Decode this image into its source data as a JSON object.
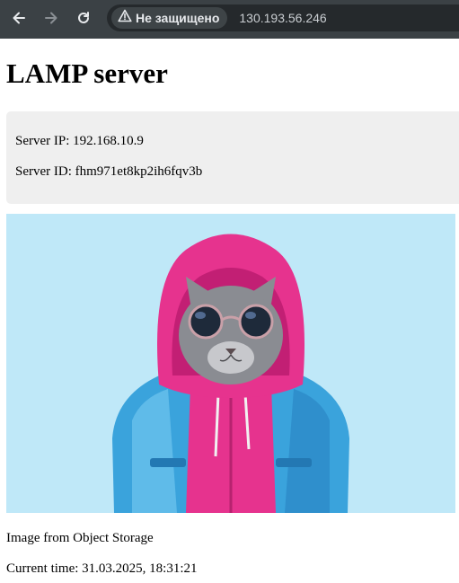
{
  "browser": {
    "security_label": "Не защищено",
    "url": "130.193.56.246",
    "icons": {
      "back": "arrow-left-icon",
      "forward": "arrow-right-icon",
      "reload": "reload-icon",
      "security": "warning-triangle-icon"
    }
  },
  "page": {
    "title": "LAMP server",
    "server_ip": "Server IP: 192.168.10.9",
    "server_id": "Server ID: fhm971et8kp2ih6fqv3b",
    "image_caption": "Image from Object Storage",
    "current_time": "Current time: 31.03.2025, 18:31:21"
  },
  "colors": {
    "toolbar": "#3b4145",
    "omnibox": "#25292c",
    "info_box": "#efefef",
    "image_background": "#bfe8f8",
    "hoodie": "#e6338e",
    "jacket": "#3aa3dc"
  }
}
